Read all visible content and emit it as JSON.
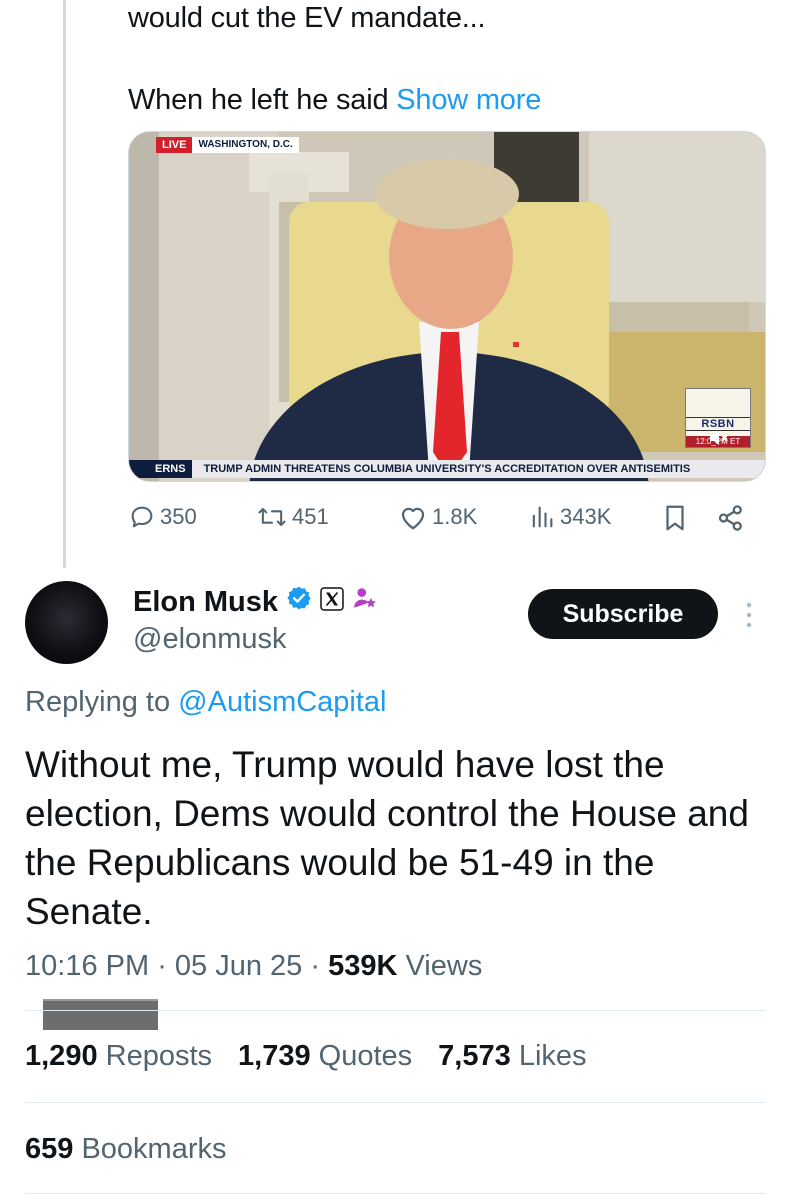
{
  "quoted_tweet": {
    "text_line_1": "would cut the EV mandate...",
    "text_line_2": "When he left he said",
    "show_more_label": "Show more",
    "video": {
      "live_label": "LIVE",
      "location_label": "WASHINGTON, D.C.",
      "network_logo": "RSBN",
      "time_label": "12:0_PM ET",
      "ticker_left": "ERNS",
      "ticker_text": "TRUMP ADMIN THREATENS COLUMBIA UNIVERSITY'S ACCREDITATION OVER ANTISEMITIS"
    },
    "actions": {
      "replies": "350",
      "reposts": "451",
      "likes": "1.8K",
      "views": "343K"
    }
  },
  "tweet": {
    "author_name": "Elon Musk",
    "handle": "@elonmusk",
    "subscribe_label": "Subscribe",
    "replying_prefix": "Replying to",
    "replying_to": "@AutismCapital",
    "text": "Without me, Trump would have lost the election, Dems would control the House and the Republicans would be 51-49 in the Senate.",
    "time": "10:16 PM",
    "date": "05 Jun 25",
    "views_count": "539K",
    "views_label": "Views",
    "reposts_count": "1,290",
    "reposts_label": "Reposts",
    "quotes_count": "1,739",
    "quotes_label": "Quotes",
    "likes_count": "7,573",
    "likes_label": "Likes",
    "bookmarks_count": "659",
    "bookmarks_label": "Bookmarks"
  },
  "colors": {
    "link": "#1d9bf0",
    "muted": "#536471",
    "verified": "#1d9bf0",
    "subscribe_bg": "#0f1419"
  },
  "icons": {
    "reply": "reply-icon",
    "repost": "repost-icon",
    "like": "heart-icon",
    "views": "views-icon",
    "bookmark": "bookmark-icon",
    "share": "share-icon",
    "verified": "verified-badge-icon",
    "x_affiliate": "x-logo-icon",
    "affiliate": "affiliate-icon",
    "more": "more-vertical-icon"
  }
}
